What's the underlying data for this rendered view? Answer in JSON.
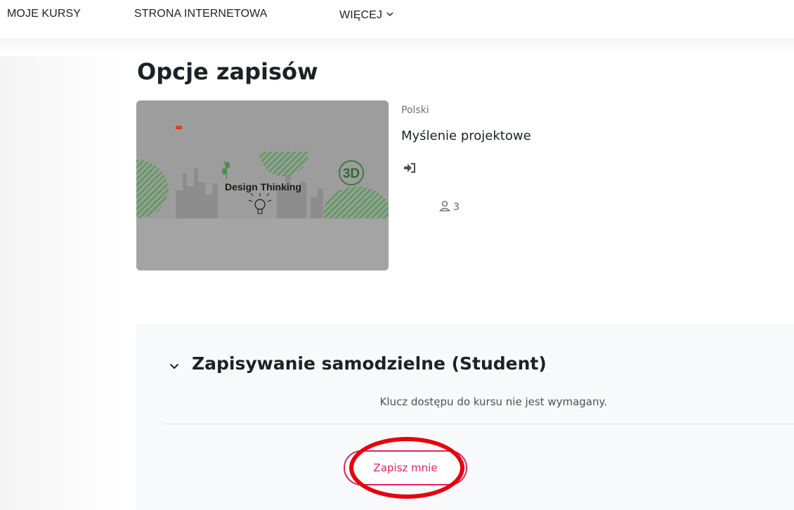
{
  "nav": {
    "items": [
      {
        "label": "MOJE KURSY"
      },
      {
        "label": "STRONA INTERNETOWA"
      },
      {
        "label": "WIĘCEJ"
      }
    ]
  },
  "page": {
    "title": "Opcje zapisów"
  },
  "course": {
    "image_text": "Design Thinking",
    "image_logo_text": "3D",
    "language": "Polski",
    "name": "Myślenie projektowe",
    "participants": "3"
  },
  "enrolment": {
    "heading": "Zapisywanie samodzielne (Student)",
    "note": "Klucz dostępu do kursu nie jest wymagany.",
    "button_label": "Zapisz mnie"
  },
  "colors": {
    "accent": "#e0245e",
    "annotation": "#e8000b",
    "panel_bg": "#f8f9fa"
  },
  "icons": {
    "more_chevron": "chevron-down-icon",
    "enrol": "sign-in-icon",
    "participants": "user-icon",
    "collapse": "chevron-down-icon"
  }
}
